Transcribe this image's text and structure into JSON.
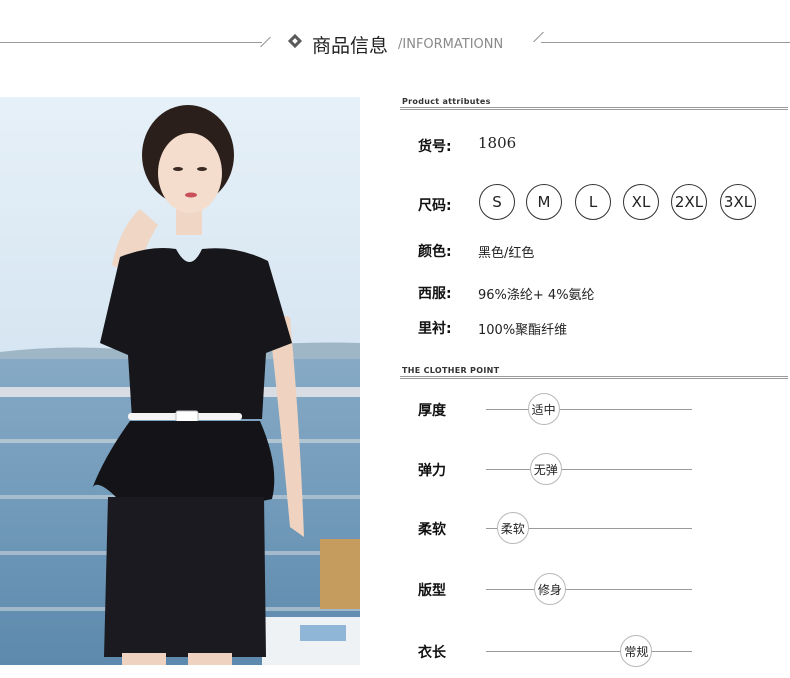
{
  "header": {
    "title_cn": "商品信息",
    "title_en": "/INFORMATIONN"
  },
  "attributes": {
    "section_title": "Product attributes",
    "item_no": {
      "label": "货号:",
      "value": "1806"
    },
    "size": {
      "label": "尺码:",
      "options": [
        "S",
        "M",
        "L",
        "XL",
        "2XL",
        "3XL"
      ]
    },
    "color": {
      "label": "颜色:",
      "value": "黑色/红色"
    },
    "suit": {
      "label": "西服:",
      "value": "96%涤纶+ 4%氨纶"
    },
    "lining": {
      "label": "里衬:",
      "value": "100%聚酯纤维"
    }
  },
  "points": {
    "section_title": "THE CLOTHER POINT",
    "items": [
      {
        "label": "厚度",
        "value": "适中",
        "level": 0.28
      },
      {
        "label": "弹力",
        "value": "无弹",
        "level": 0.29
      },
      {
        "label": "柔软",
        "value": "柔软",
        "level": 0.13
      },
      {
        "label": "版型",
        "value": "修身",
        "level": 0.31
      },
      {
        "label": "衣长",
        "value": "常规",
        "level": 0.73
      }
    ]
  },
  "colors": {
    "garment": "#15151a",
    "sky": "#cfe3f1",
    "sea": "#6f9bbb",
    "line": "#9a9a9a"
  }
}
